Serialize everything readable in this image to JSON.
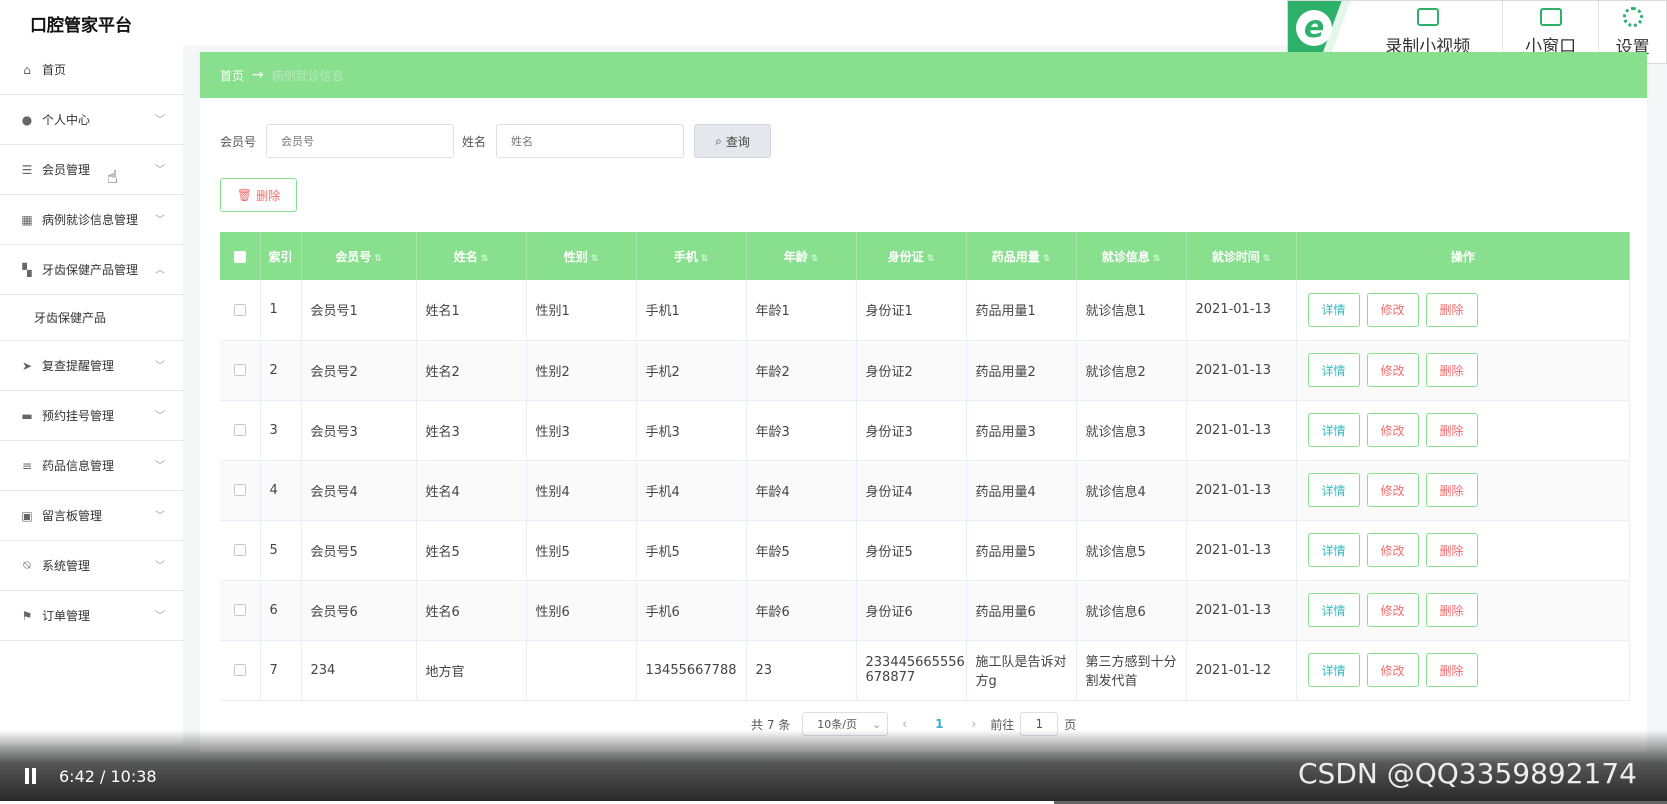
{
  "app": {
    "title": "口腔管家平台"
  },
  "recorder": {
    "items": [
      {
        "label": "录制小视频",
        "icon": "video-camera-icon"
      },
      {
        "label": "小窗口",
        "icon": "tv-icon"
      },
      {
        "label": "设置",
        "icon": "gear-icon"
      }
    ]
  },
  "sidebar": {
    "items": [
      {
        "label": "首页",
        "icon": "home-icon"
      },
      {
        "label": "个人中心",
        "icon": "user-icon"
      },
      {
        "label": "会员管理",
        "icon": "sliders-icon"
      },
      {
        "label": "病例就诊信息管理",
        "icon": "grid-icon"
      },
      {
        "label": "牙齿保健产品管理",
        "icon": "apps-icon"
      },
      {
        "label": "牙齿保健产品"
      },
      {
        "label": "复查提醒管理",
        "icon": "send-icon"
      },
      {
        "label": "预约挂号管理",
        "icon": "briefcase-icon"
      },
      {
        "label": "药品信息管理",
        "icon": "list-icon"
      },
      {
        "label": "留言板管理",
        "icon": "clipboard-icon"
      },
      {
        "label": "系统管理",
        "icon": "bell-off-icon"
      },
      {
        "label": "订单管理",
        "icon": "flag-icon"
      }
    ]
  },
  "breadcrumb": {
    "home": "首页",
    "current": "病例就诊信息"
  },
  "search": {
    "member_label": "会员号",
    "member_placeholder": "会员号",
    "name_label": "姓名",
    "name_placeholder": "姓名",
    "query_button": "查询"
  },
  "toolbar": {
    "delete_button": "删除"
  },
  "table": {
    "columns": [
      "索引",
      "会员号",
      "姓名",
      "性别",
      "手机",
      "年龄",
      "身份证",
      "药品用量",
      "就诊信息",
      "就诊时间",
      "操作"
    ],
    "rows": [
      [
        "1",
        "会员号1",
        "姓名1",
        "性别1",
        "手机1",
        "年龄1",
        "身份证1",
        "药品用量1",
        "就诊信息1",
        "2021-01-13"
      ],
      [
        "2",
        "会员号2",
        "姓名2",
        "性别2",
        "手机2",
        "年龄2",
        "身份证2",
        "药品用量2",
        "就诊信息2",
        "2021-01-13"
      ],
      [
        "3",
        "会员号3",
        "姓名3",
        "性别3",
        "手机3",
        "年龄3",
        "身份证3",
        "药品用量3",
        "就诊信息3",
        "2021-01-13"
      ],
      [
        "4",
        "会员号4",
        "姓名4",
        "性别4",
        "手机4",
        "年龄4",
        "身份证4",
        "药品用量4",
        "就诊信息4",
        "2021-01-13"
      ],
      [
        "5",
        "会员号5",
        "姓名5",
        "性别5",
        "手机5",
        "年龄5",
        "身份证5",
        "药品用量5",
        "就诊信息5",
        "2021-01-13"
      ],
      [
        "6",
        "会员号6",
        "姓名6",
        "性别6",
        "手机6",
        "年龄6",
        "身份证6",
        "药品用量6",
        "就诊信息6",
        "2021-01-13"
      ],
      [
        "7",
        "234",
        "地方官",
        "",
        "13455667788",
        "23",
        "233445665556678877",
        "施工队是告诉对方g",
        "第三方感到十分割发代首",
        "2021-01-12"
      ]
    ],
    "actions": {
      "detail": "详情",
      "edit": "修改",
      "delete": "删除"
    }
  },
  "pagination": {
    "total": "共 7 条",
    "page_size": "10条/页",
    "current_page": "1",
    "goto_label": "前往",
    "goto_value": "1",
    "page_suffix": "页"
  },
  "player": {
    "time": "6:42 / 10:38",
    "watermark": "CSDN @QQ3359892174",
    "progress": 0.632
  },
  "colors": {
    "accent_green": "#88e08e",
    "link_cyan": "#36b6c3",
    "danger_red": "#f56c6c"
  }
}
